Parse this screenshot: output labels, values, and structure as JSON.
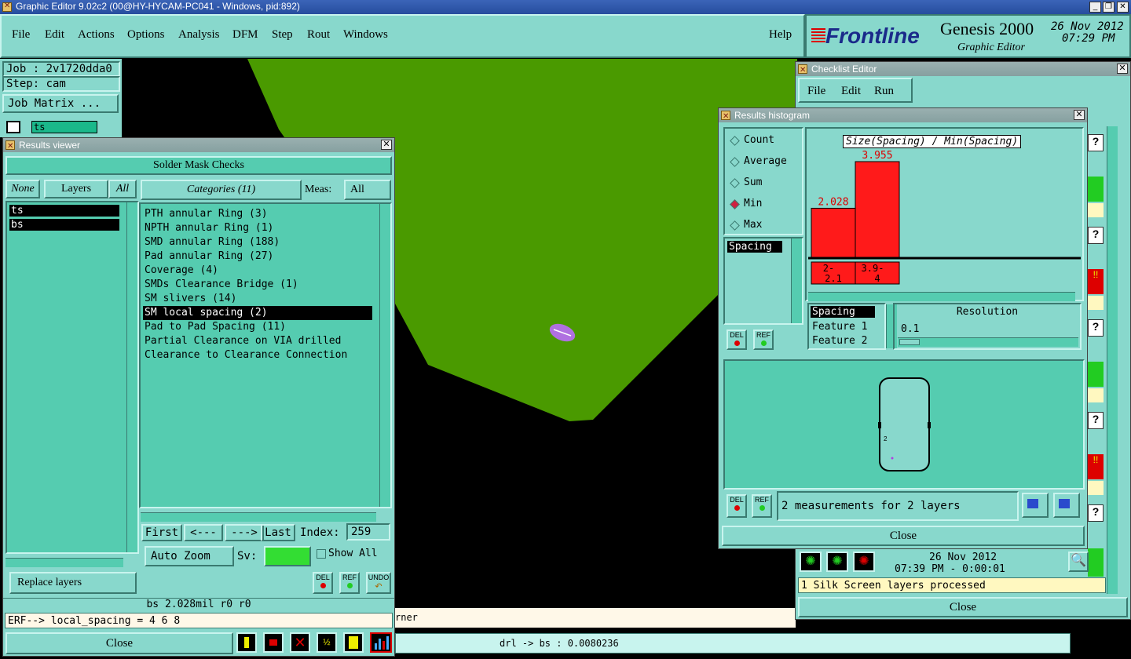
{
  "app_title": "Graphic Editor 9.02c2 (00@HY-HYCAM-PC041 - Windows, pid:892)",
  "menu": [
    "File",
    "Edit",
    "Actions",
    "Options",
    "Analysis",
    "DFM",
    "Step",
    "Rout",
    "Windows"
  ],
  "help": "Help",
  "brand": {
    "logo": "Frontline",
    "product": "Genesis 2000",
    "subtitle": "Graphic Editor",
    "date": "26 Nov 2012",
    "time": "07:29 PM"
  },
  "job": {
    "job": "Job : 2v1720dda0",
    "step": "Step: cam",
    "matrix_btn": "Job Matrix ...",
    "layer": "ts"
  },
  "results_viewer": {
    "title": "Results viewer",
    "header": "Solder Mask Checks",
    "none": "None",
    "layers": "Layers",
    "all": "All",
    "categories_btn": "Categories (11)",
    "meas_label": "Meas:",
    "meas_value": "All",
    "layer_items": [
      "ts",
      "bs"
    ],
    "categories": [
      "PTH annular Ring (3)",
      "NPTH annular Ring (1)",
      "SMD annular Ring (188)",
      "Pad annular Ring (27)",
      "Coverage (4)",
      "SMDs Clearance Bridge (1)",
      "SM slivers (14)",
      "SM local spacing (2)",
      "Pad to Pad Spacing (11)",
      "Partial Clearance on VIA drilled",
      "Clearance to Clearance Connection"
    ],
    "first": "First",
    "prev": "<---",
    "next": "--->",
    "last": "Last",
    "index_label": "Index:",
    "index_value": "259",
    "auto_zoom": "Auto Zoom",
    "sv": "Sv:",
    "show_all": "Show All",
    "replace_layers": "Replace layers",
    "del": "DEL",
    "ref": "REF",
    "undo": "UNDO",
    "status": "bs 2.028mil  r0  r0",
    "erf": "ERF--> local_spacing = 4 6 8",
    "close": "Close"
  },
  "bottom": {
    "corner_text": "rner",
    "drl": "drl -> bs : 0.0080236"
  },
  "checklist": {
    "title": "Checklist Editor",
    "menu": [
      "File",
      "Edit",
      "Run"
    ],
    "date": "26 Nov 2012",
    "time": "07:39 PM - 0:00:01",
    "status": "1 Silk Screen layers processed",
    "close": "Close"
  },
  "histogram": {
    "title": "Results histogram",
    "modes": [
      "Count",
      "Average",
      "Sum",
      "Min",
      "Max"
    ],
    "selected_mode": "Min",
    "chart_title": "Size(Spacing) / Min(Spacing)",
    "list": [
      "Spacing"
    ],
    "sel_list": [
      "Spacing",
      "Feature 1",
      "Feature 2"
    ],
    "resolution_label": "Resolution",
    "resolution_value": "0.1",
    "measurements": "2 measurements for 2 layers",
    "close": "Close",
    "del": "DEL",
    "ref": "REF"
  },
  "chart_data": {
    "type": "bar",
    "title": "Size(Spacing) / Min(Spacing)",
    "categories": [
      "2-2.1",
      "3.9-4"
    ],
    "values": [
      2.028,
      3.955
    ]
  },
  "colors": {
    "teal": "#88d8cc",
    "green_area": "#4a9a00",
    "bar_red": "#ff1a1a",
    "title_blue": "#3b64b8"
  }
}
